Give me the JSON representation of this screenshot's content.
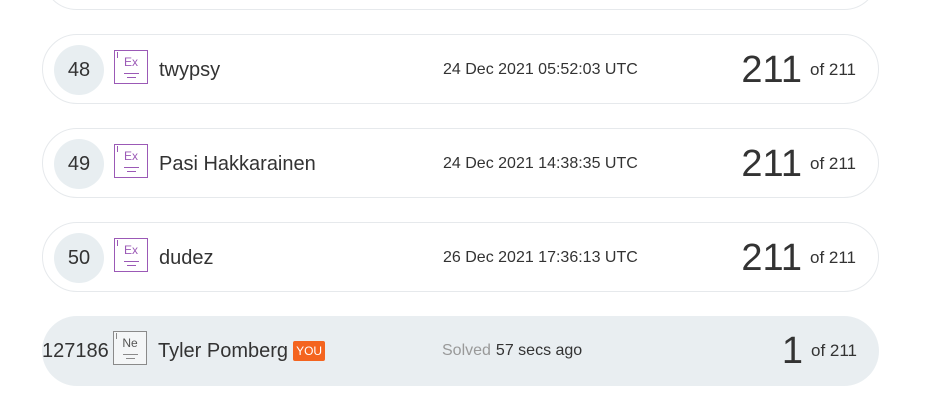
{
  "rows": [
    {
      "rank": "48",
      "badge": "Ex",
      "username": "twypsy",
      "solved": "24 Dec 2021 05:52:03 UTC",
      "score": "211",
      "total": "of 211"
    },
    {
      "rank": "49",
      "badge": "Ex",
      "username": "Pasi Hakkarainen",
      "solved": "24 Dec 2021 14:38:35 UTC",
      "score": "211",
      "total": "of 211"
    },
    {
      "rank": "50",
      "badge": "Ex",
      "username": "dudez",
      "solved": "26 Dec 2021 17:36:13 UTC",
      "score": "211",
      "total": "of 211"
    }
  ],
  "current_user": {
    "rank": "127186",
    "badge": "Ne",
    "username": "Tyler Pomberg",
    "you_tag": "YOU",
    "solved_label": "Solved",
    "solved_time": "57 secs ago",
    "score": "1",
    "total": "of 211"
  },
  "colors": {
    "expert_badge": "#9b59b6",
    "newbie_badge": "#8a8a8a",
    "you_tag": "#f4641f",
    "current_row_bg": "#e9eef1",
    "rank_circle": "#e8eef1"
  }
}
